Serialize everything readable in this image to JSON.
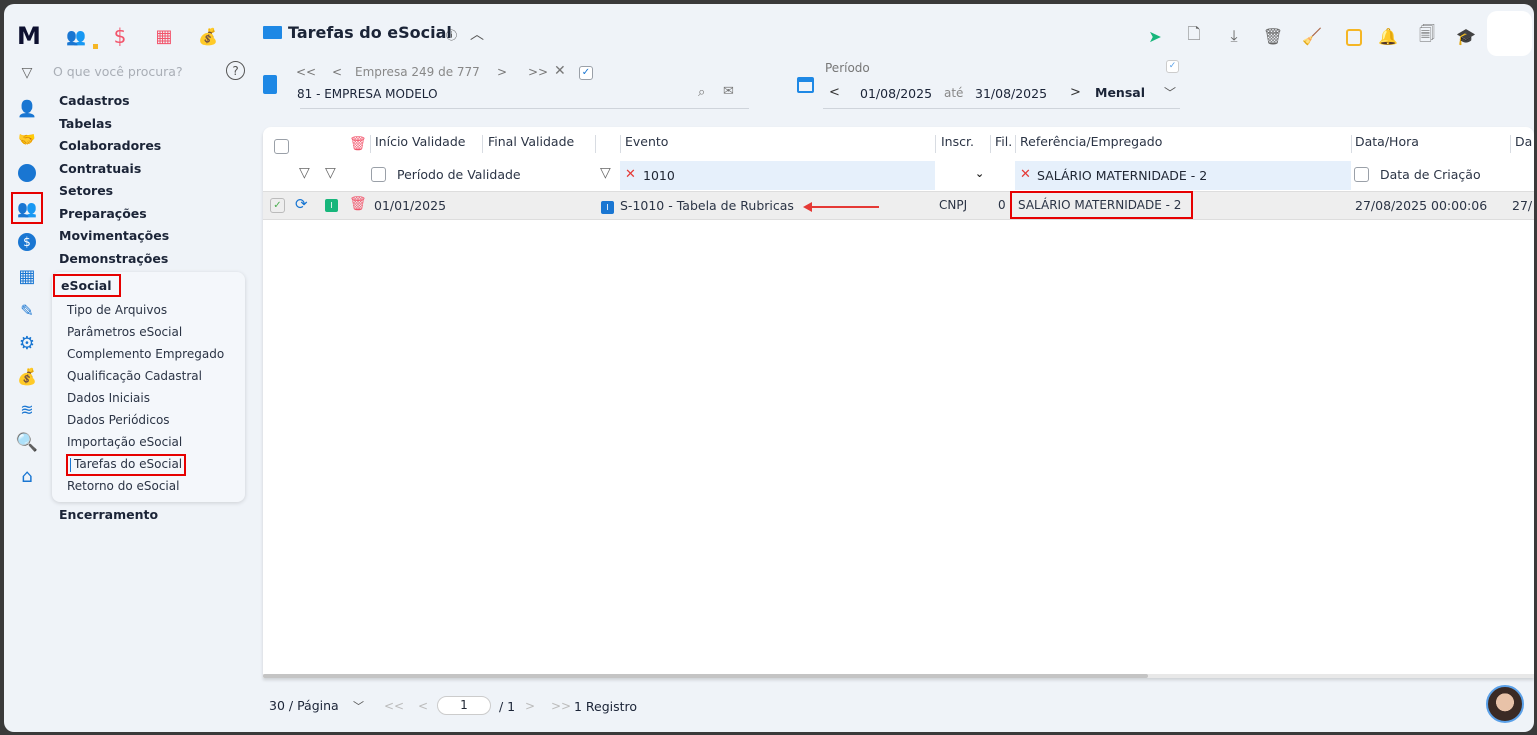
{
  "app": {
    "logo": "M",
    "top_icons": [
      "team-icon",
      "dollar-icon",
      "calculator-icon",
      "money-bag-icon"
    ]
  },
  "sidebar": {
    "search_placeholder": "O que você procura?",
    "menu": [
      "Cadastros",
      "Tabelas",
      "Colaboradores",
      "Contratuais",
      "Setores",
      "Preparações",
      "Movimentações",
      "Demonstrações"
    ],
    "esocial": {
      "label": "eSocial",
      "items": [
        "Tipo de Arquivos",
        "Parâmetros eSocial",
        "Complemento Empregado",
        "Qualificação Cadastral",
        "Dados Iniciais",
        "Dados Periódicos",
        "Importação eSocial",
        "Tarefas do eSocial",
        "Retorno do eSocial"
      ]
    },
    "last": "Encerramento"
  },
  "header": {
    "title": "Tarefas do eSocial",
    "company_nav": "Empresa 249 de 777",
    "company": "81 - EMPRESA MODELO",
    "period_label": "Período",
    "date_from": "01/08/2025",
    "until": "até",
    "date_to": "31/08/2025",
    "period_type": "Mensal"
  },
  "table": {
    "headers": {
      "inicio": "Início Validade",
      "final": "Final Validade",
      "evento": "Evento",
      "inscr": "Inscr.",
      "fil": "Fil.",
      "ref": "Referência/Empregado",
      "datahora": "Data/Hora",
      "da": "Da"
    },
    "filters": {
      "periodo": "Período de Validade",
      "evento": "1010",
      "ref": "SALÁRIO MATERNIDADE - 2",
      "criacao": "Data de Criação"
    },
    "rows": [
      {
        "status": "I",
        "inicio": "01/01/2025",
        "evento_badge": "I",
        "evento": "S-1010 - Tabela de Rubricas",
        "inscr": "CNPJ",
        "fil": "0",
        "ref": "SALÁRIO MATERNIDADE - 2",
        "datahora": "27/08/2025 00:00:06",
        "extra": "27/"
      }
    ]
  },
  "pagination": {
    "per_page": "30 / Página",
    "page": "1",
    "total_pages": "/ 1",
    "records": "1 Registro"
  },
  "colors": {
    "accent": "#1976d2",
    "highlight": "#e60000",
    "filter_bg": "#e6f0fb",
    "status_green": "#17b67b"
  }
}
